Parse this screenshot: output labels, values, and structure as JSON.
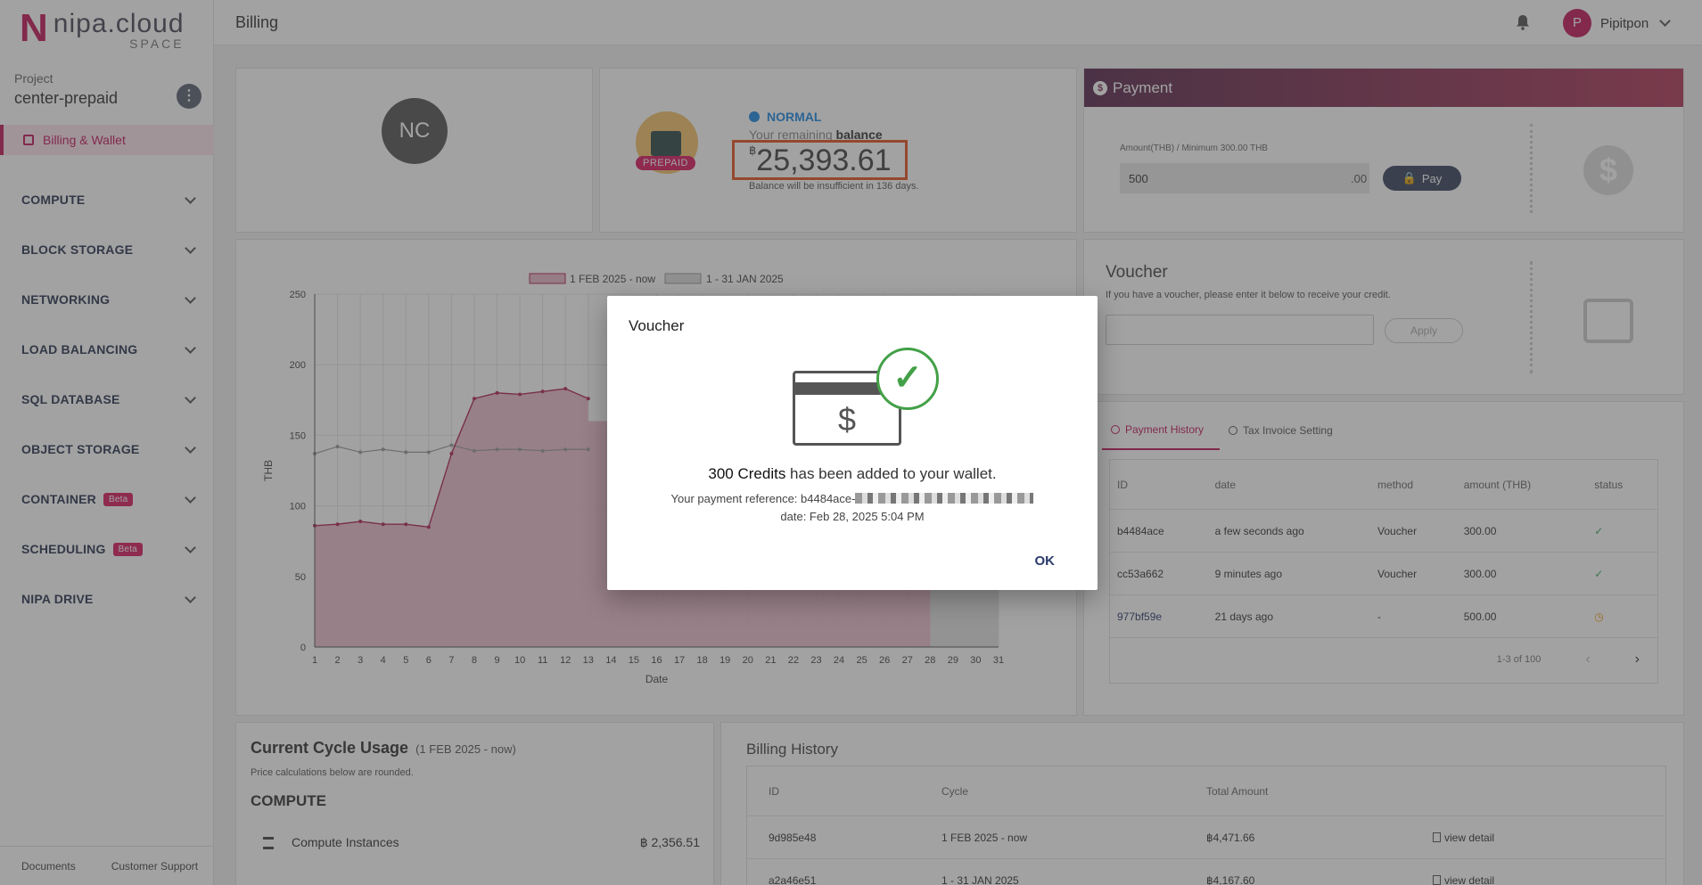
{
  "brand": {
    "name": "nipa.cloud",
    "sub": "SPACE"
  },
  "sidebar": {
    "project_label": "Project",
    "project_name": "center-prepaid",
    "kebab": "⋮",
    "active_item": "Billing & Wallet",
    "items": [
      {
        "label": "COMPUTE",
        "beta": ""
      },
      {
        "label": "BLOCK STORAGE",
        "beta": ""
      },
      {
        "label": "NETWORKING",
        "beta": ""
      },
      {
        "label": "LOAD BALANCING",
        "beta": ""
      },
      {
        "label": "SQL DATABASE",
        "beta": ""
      },
      {
        "label": "OBJECT STORAGE",
        "beta": ""
      },
      {
        "label": "CONTAINER",
        "beta": "Beta"
      },
      {
        "label": "SCHEDULING",
        "beta": "Beta"
      },
      {
        "label": "NIPA DRIVE",
        "beta": ""
      }
    ],
    "footer": {
      "documents": "Documents",
      "support": "Customer Support"
    }
  },
  "header": {
    "title": "Billing",
    "user_initial": "P",
    "user_name": "Pipitpon"
  },
  "profile": {
    "initials": "NC"
  },
  "balance": {
    "plan": "PREPAID",
    "status": "NORMAL",
    "remaining_prefix": "Your remaining ",
    "remaining_bold": "balance",
    "currency": "฿",
    "amount": "25,393.61",
    "note": "Balance will be insufficient in 136 days."
  },
  "payment": {
    "title": "Payment",
    "amount_label": "Amount(THB) / Minimum 300.00 THB",
    "amount_value": "500",
    "decimals": ".00",
    "pay_label": "Pay"
  },
  "voucher": {
    "title": "Voucher",
    "description": "If you have a voucher, please enter it below to receive your credit.",
    "input_value": "",
    "apply_label": "Apply"
  },
  "history": {
    "tabs": [
      "Payment History",
      "Tax Invoice Setting"
    ],
    "columns": [
      "ID",
      "date",
      "method",
      "amount (THB)",
      "status"
    ],
    "rows": [
      {
        "id": "b4484ace",
        "date": "a few seconds ago",
        "method": "Voucher",
        "amount": "300.00",
        "status": "success"
      },
      {
        "id": "cc53a662",
        "date": "9 minutes ago",
        "method": "Voucher",
        "amount": "300.00",
        "status": "success"
      },
      {
        "id": "977bf59e",
        "date": "21 days ago",
        "method": "-",
        "amount": "500.00",
        "status": "pending"
      }
    ],
    "pagination": "1-3 of 100"
  },
  "usage": {
    "title": "Current Cycle Usage",
    "cycle": "(1 FEB 2025 - now)",
    "note": "Price calculations below are rounded.",
    "section": "COMPUTE",
    "items": [
      {
        "name": "Compute Instances",
        "amount": "฿ 2,356.51"
      }
    ]
  },
  "billing_history": {
    "title": "Billing History",
    "columns": [
      "ID",
      "Cycle",
      "Total Amount",
      ""
    ],
    "rows": [
      {
        "id": "9d985e48",
        "cycle": "1 FEB 2025 - now",
        "total": "฿4,471.66",
        "action": "view detail"
      },
      {
        "id": "a2a46e51",
        "cycle": "1 - 31 JAN 2025",
        "total": "฿4,167.60",
        "action": "view detail"
      }
    ]
  },
  "modal": {
    "title": "Voucher",
    "credits": "300 Credits",
    "message": " has been added to your wallet.",
    "reference_label": "Your payment reference: b4484ace-",
    "date": "date: Feb 28, 2025 5:04 PM",
    "ok_label": "OK"
  },
  "chart_data": {
    "type": "area",
    "xlabel": "Date",
    "ylabel": "THB",
    "ylim": [
      0,
      250
    ],
    "yticks": [
      0,
      50,
      100,
      150,
      200,
      250
    ],
    "x": [
      1,
      2,
      3,
      4,
      5,
      6,
      7,
      8,
      9,
      10,
      11,
      12,
      13,
      14,
      15,
      16,
      17,
      18,
      19,
      20,
      21,
      22,
      23,
      24,
      25,
      26,
      27,
      28,
      29,
      30,
      31
    ],
    "legend_position": "top",
    "series": [
      {
        "name": "1 FEB 2025 - now",
        "color": "#d98aa5",
        "values": [
          86,
          87,
          89,
          87,
          87,
          85,
          137,
          176,
          180,
          179,
          181,
          183,
          176,
          null,
          null,
          null,
          null,
          null,
          null,
          null,
          null,
          null,
          null,
          null,
          null,
          null,
          null,
          null
        ]
      },
      {
        "name": "1 - 31 JAN 2025",
        "color": "#c8c8c8",
        "values": [
          137,
          142,
          138,
          140,
          138,
          138,
          143,
          139,
          140,
          140,
          139,
          140,
          140,
          null,
          null,
          null,
          null,
          null,
          null,
          null,
          null,
          null,
          null,
          null,
          null,
          null,
          null,
          null,
          null,
          null,
          null
        ]
      }
    ],
    "filled_through_day": 28
  }
}
